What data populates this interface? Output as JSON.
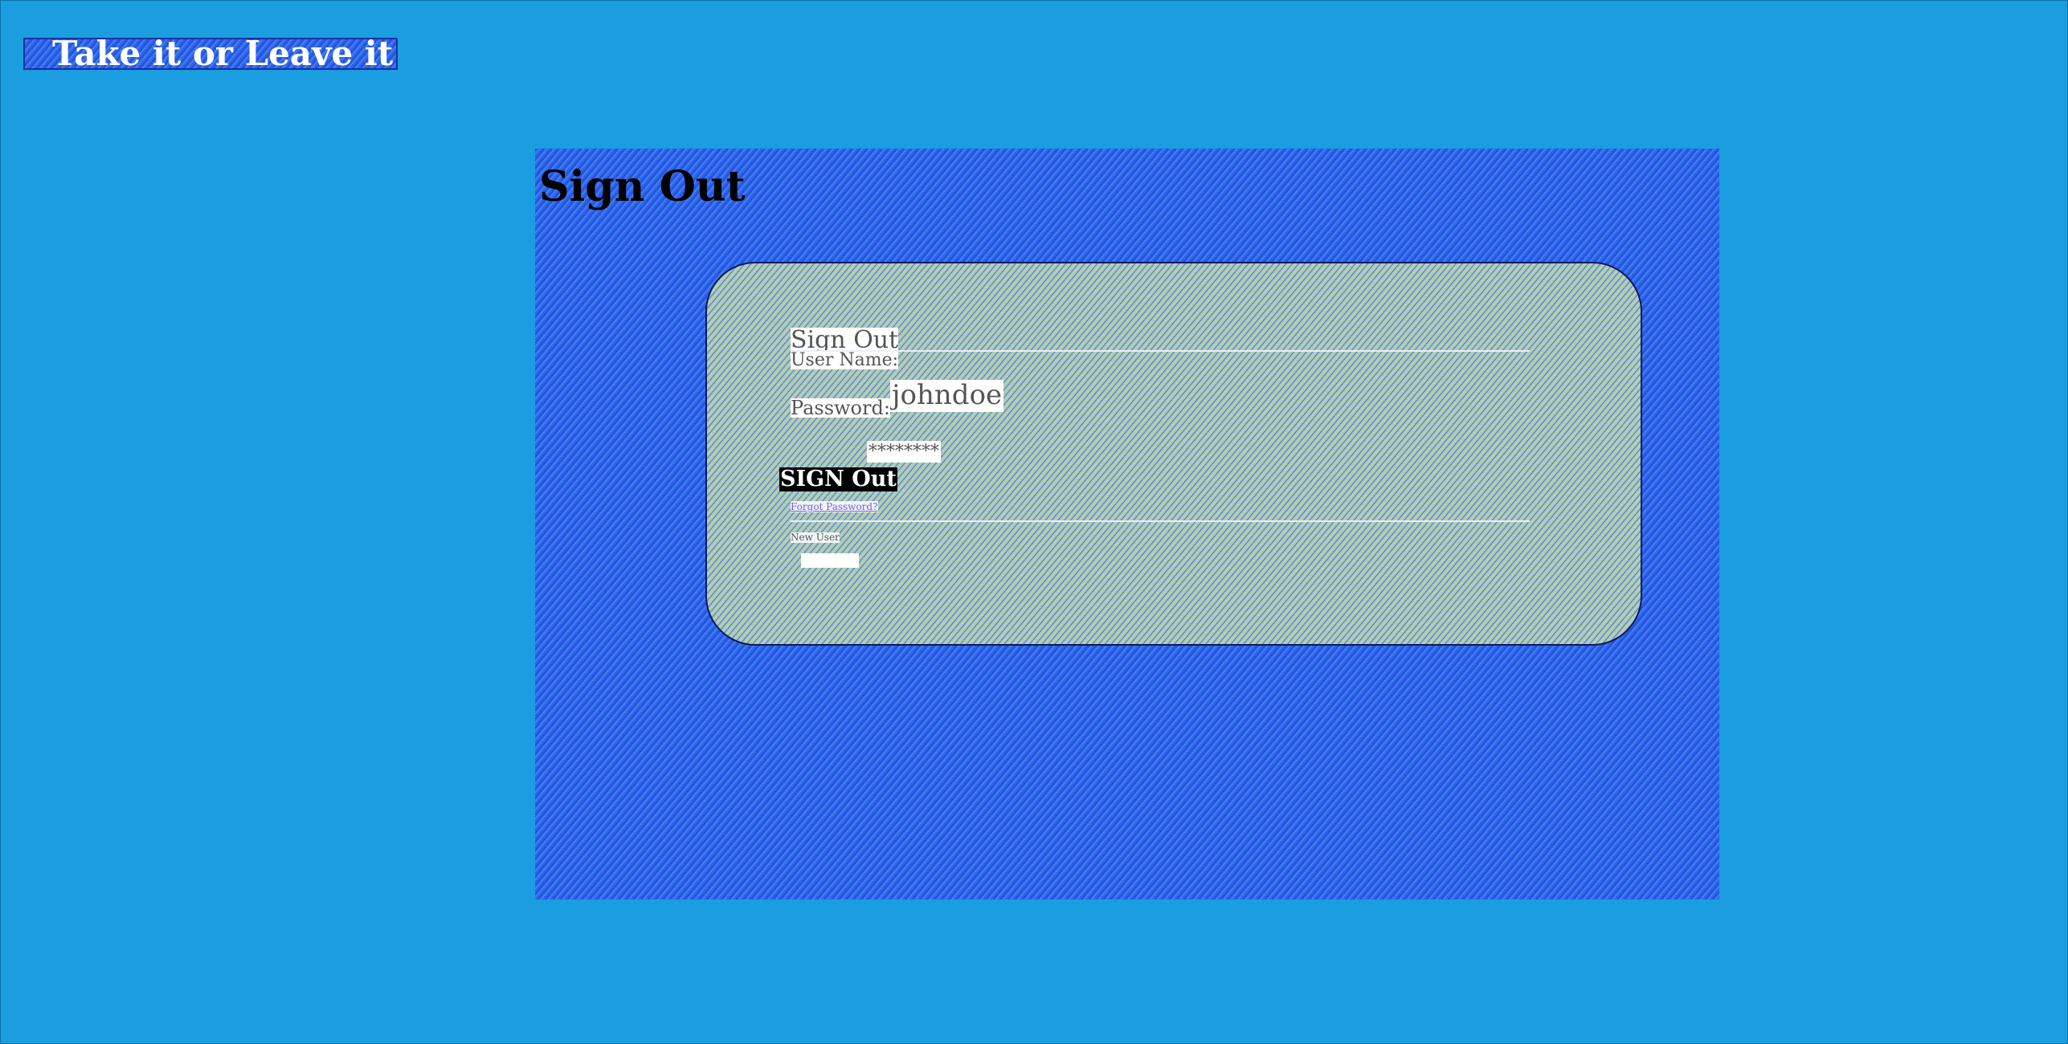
{
  "site": {
    "logo_text": "Take it or Leave it"
  },
  "page": {
    "title": "Sign Out"
  },
  "form": {
    "legend": "Sign Out",
    "username_label": "User Name:",
    "username_value": "johndoe",
    "password_label": "Password:",
    "password_value": "********",
    "submit_label": "SIGN Out",
    "forgot_link": "Forgot Password?",
    "new_user_label": "New User"
  },
  "colors": {
    "page_background": "#1a9ee0",
    "panel_background": "#2f63f0",
    "button_background": "#000000",
    "link_color": "#7a5cf0"
  }
}
